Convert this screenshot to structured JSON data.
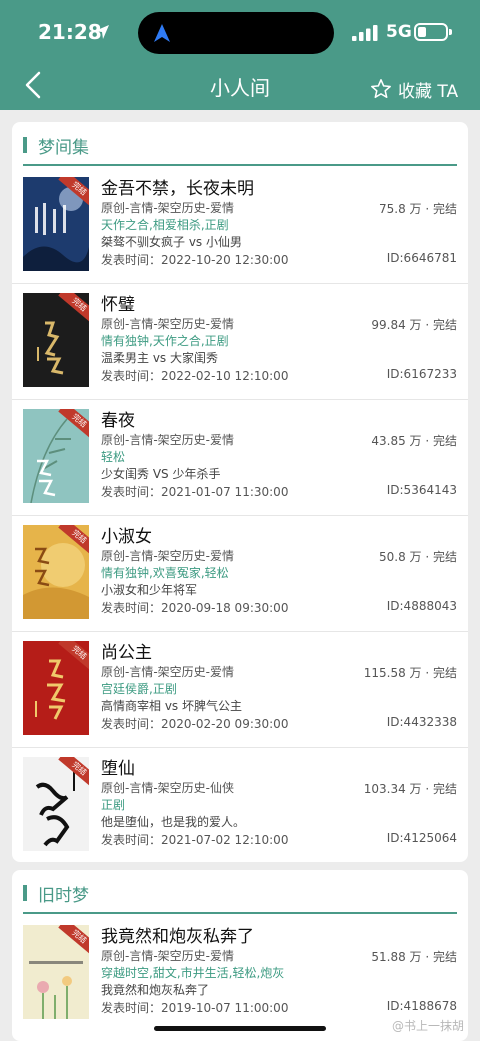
{
  "status_bar": {
    "time": "21:28",
    "network": "5G"
  },
  "nav": {
    "title": "小人间",
    "favorite_label": "收藏 TA"
  },
  "sections": [
    {
      "title": "梦间集",
      "books": [
        {
          "title": "金吾不禁，长夜未明",
          "category": "原创-言情-架空历史-爱情",
          "tags": "天作之合,相爱相杀,正剧",
          "desc": "桀骜不驯女疯子 vs 小仙男",
          "publish": "发表时间：2022-10-20 12:30:00",
          "count": "75.8 万 · 完结",
          "id": "ID:6646781",
          "cover_color": "#1d3b6e",
          "badge": "完结"
        },
        {
          "title": "怀璧",
          "category": "原创-言情-架空历史-爱情",
          "tags": "情有独钟,天作之合,正剧",
          "desc": "温柔男主 vs 大家闺秀",
          "publish": "发表时间：2022-02-10 12:10:00",
          "count": "99.84 万 · 完结",
          "id": "ID:6167233",
          "cover_color": "#1c1c1c",
          "badge": "完结"
        },
        {
          "title": "春夜",
          "category": "原创-言情-架空历史-爱情",
          "tags": "轻松",
          "desc": "少女闺秀 VS 少年杀手",
          "publish": "发表时间：2021-01-07 11:30:00",
          "count": "43.85 万 · 完结",
          "id": "ID:5364143",
          "cover_color": "#8fc4c0",
          "badge": "完结"
        },
        {
          "title": "小淑女",
          "category": "原创-言情-架空历史-爱情",
          "tags": "情有独钟,欢喜冤家,轻松",
          "desc": "小淑女和少年将军",
          "publish": "发表时间：2020-09-18 09:30:00",
          "count": "50.8 万 · 完结",
          "id": "ID:4888043",
          "cover_color": "#e6b44a",
          "badge": "完结"
        },
        {
          "title": "尚公主",
          "category": "原创-言情-架空历史-爱情",
          "tags": "宫廷侯爵,正剧",
          "desc": "高情商宰相 vs 坏脾气公主",
          "publish": "发表时间：2020-02-20 09:30:00",
          "count": "115.58 万 · 完结",
          "id": "ID:4432338",
          "cover_color": "#b51d18",
          "badge": "完结"
        },
        {
          "title": "堕仙",
          "category": "原创-言情-架空历史-仙侠",
          "tags": "正剧",
          "desc": "他是堕仙，也是我的爱人。",
          "publish": "发表时间：2021-07-02 12:10:00",
          "count": "103.34 万 · 完结",
          "id": "ID:4125064",
          "cover_color": "#f2f2f2",
          "badge": "完结"
        }
      ]
    },
    {
      "title": "旧时梦",
      "books": [
        {
          "title": "我竟然和炮灰私奔了",
          "category": "原创-言情-架空历史-爱情",
          "tags": "穿越时空,甜文,市井生活,轻松,炮灰",
          "desc": "我竟然和炮灰私奔了",
          "publish": "发表时间：2019-10-07 11:00:00",
          "count": "51.88 万 · 完结",
          "id": "ID:4188678",
          "cover_color": "#f1eccf",
          "badge": "完结"
        }
      ]
    }
  ],
  "watermark": "@书上一抹胡"
}
